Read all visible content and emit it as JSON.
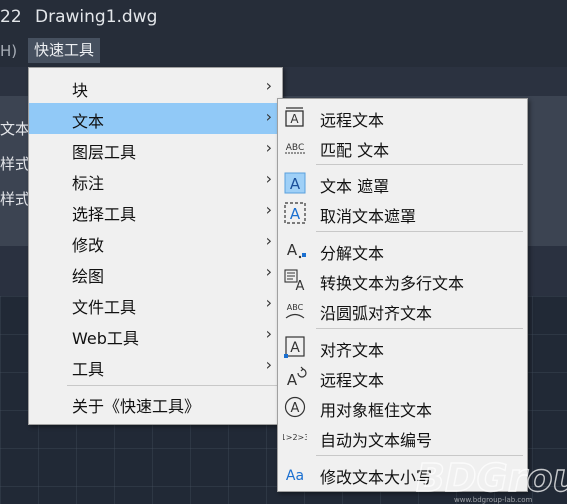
{
  "title": {
    "number": "22",
    "filename": "Drawing1.dwg"
  },
  "menubar": {
    "left_fragment": "H)",
    "active_menu": "快速工具"
  },
  "panel": {
    "items": [
      "文本",
      "样式",
      "样式"
    ]
  },
  "menu": {
    "items": [
      {
        "label": "块",
        "submenu": true
      },
      {
        "label": "文本",
        "submenu": true,
        "highlighted": true
      },
      {
        "label": "图层工具",
        "submenu": true
      },
      {
        "label": "标注",
        "submenu": true
      },
      {
        "label": "选择工具",
        "submenu": true
      },
      {
        "label": "修改",
        "submenu": true
      },
      {
        "label": "绘图",
        "submenu": true
      },
      {
        "label": "文件工具",
        "submenu": true
      },
      {
        "label": "Web工具",
        "submenu": true
      },
      {
        "label": "工具",
        "submenu": true
      }
    ],
    "about": "关于《快速工具》",
    "arrow": "›"
  },
  "submenu": {
    "items": [
      {
        "label": "远程文本",
        "icon": "remote-text-icon"
      },
      {
        "label": "匹配 文本",
        "icon": "match-text-icon",
        "icon_text": "ABC"
      },
      {
        "label": "文本 遮罩",
        "icon": "text-mask-icon"
      },
      {
        "label": "取消文本遮罩",
        "icon": "unmask-text-icon"
      },
      {
        "label": "分解文本",
        "icon": "explode-text-icon"
      },
      {
        "label": "转换文本为多行文本",
        "icon": "convert-mtext-icon"
      },
      {
        "label": "沿圆弧对齐文本",
        "icon": "arc-align-text-icon",
        "icon_text": "ABC"
      },
      {
        "label": "对齐文本",
        "icon": "align-text-icon"
      },
      {
        "label": "远程文本",
        "icon": "remote-text-refresh-icon"
      },
      {
        "label": "用对象框住文本",
        "icon": "enclose-text-icon"
      },
      {
        "label": "自动为文本编号",
        "icon": "auto-number-icon",
        "icon_text": "1>2>3"
      },
      {
        "label": "修改文本大小写",
        "icon": "change-case-icon",
        "icon_text": "Aa"
      }
    ]
  },
  "watermark": {
    "text": "BDGroup",
    "url": "www.bdgroup-lab.com"
  },
  "colors": {
    "highlight": "#91c9f7",
    "menu_bg": "#f0f0f0",
    "icon_blue": "#1a6fd0"
  }
}
